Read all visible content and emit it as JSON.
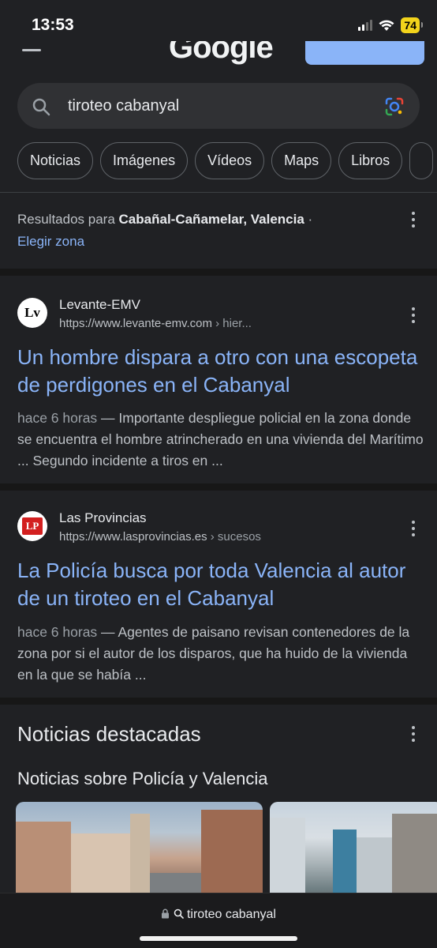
{
  "status_bar": {
    "time": "13:53",
    "battery": "74"
  },
  "header": {
    "logo": "Google"
  },
  "search": {
    "query": "tiroteo cabanyal"
  },
  "chips": [
    "Noticias",
    "Imágenes",
    "Vídeos",
    "Maps",
    "Libros"
  ],
  "location": {
    "prefix": "Resultados para ",
    "place": "Cabañal-Cañamelar, Valencia",
    "suffix": " ·",
    "link": "Elegir zona"
  },
  "results": [
    {
      "favicon": "Lv",
      "site": "Levante-EMV",
      "url": "https://www.levante-emv.com",
      "crumb": " › hier...",
      "title": "Un hombre dispara a otro con una escopeta de perdigones en el Cabanyal",
      "date": "hace 6 horas",
      "snippet": " — Importante despliegue policial en la zona donde se encuentra el hombre atrincherado en una vivienda del Marítimo ... Segundo incidente a tiros en ..."
    },
    {
      "favicon": "LP",
      "site": "Las Provincias",
      "url": "https://www.lasprovincias.es",
      "crumb": " › sucesos",
      "title": "La Policía busca por toda Valencia al autor de un tiroteo en el Cabanyal",
      "date": "hace 6 horas",
      "snippet": " — Agentes de paisano revisan contenedores de la zona por si el autor de los disparos, que ha huido de la vivienda en la que se había ..."
    }
  ],
  "news": {
    "heading": "Noticias destacadas",
    "subheading": "Noticias sobre Policía y Valencia"
  },
  "bottom_bar": {
    "address": "tiroteo cabanyal"
  }
}
